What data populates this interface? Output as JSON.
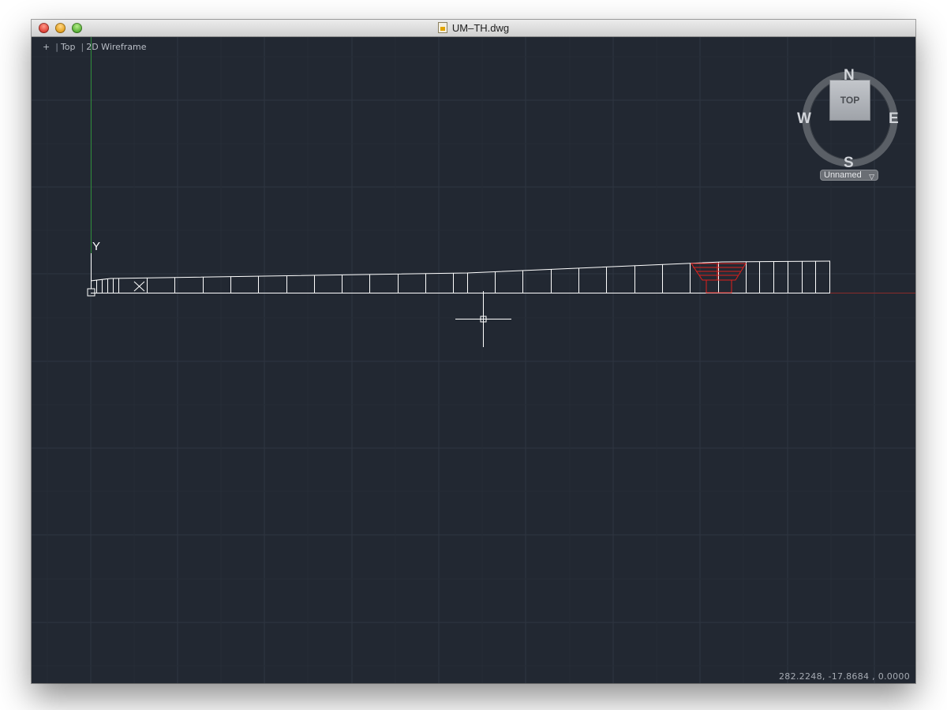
{
  "window": {
    "title": "UM–TH.dwg"
  },
  "viewport": {
    "controls": [
      "+",
      "Top",
      "2D Wireframe"
    ]
  },
  "viewcube": {
    "north": "N",
    "south": "S",
    "east": "E",
    "west": "W",
    "face": "TOP"
  },
  "ucs": {
    "y_axis_label": "Y",
    "dropdown_label": "Unnamed"
  },
  "status": {
    "coordinates": "282.2248, -17.8684 , 0.0000"
  },
  "colors": {
    "background": "#222832",
    "grid": "#343c47",
    "geometry": "#ffffff",
    "highlight": "#e0201c",
    "y_axis": "#2f8a3a",
    "x_axis": "#b03030"
  }
}
